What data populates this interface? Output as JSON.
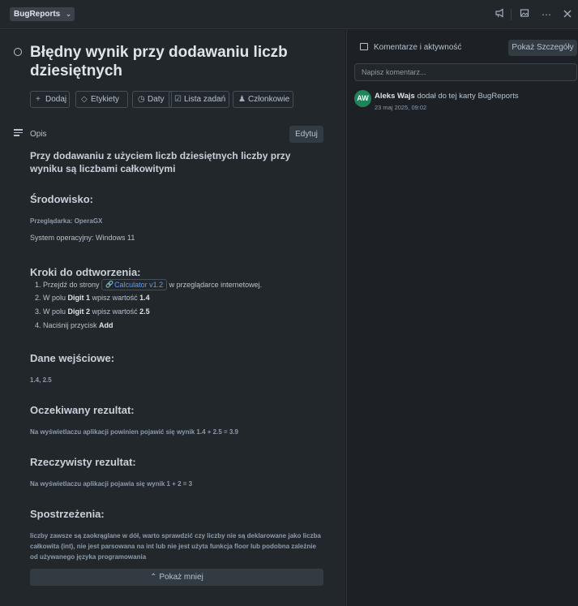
{
  "topbar": {
    "board_name": "BugReports",
    "icons": [
      "megaphone-icon",
      "image-icon",
      "more-icon",
      "close-icon"
    ]
  },
  "card": {
    "title": "Błędny wynik przy dodawaniu liczb dziesiętnych",
    "actions": [
      {
        "label": "Dodaj",
        "icon": "plus-icon"
      },
      {
        "label": "Etykiety",
        "icon": "tag-icon"
      },
      {
        "label": "Daty",
        "icon": "clock-icon"
      },
      {
        "label": "Lista zadań",
        "icon": "checklist-icon"
      },
      {
        "label": "Członkowie",
        "icon": "user-icon"
      }
    ]
  },
  "description": {
    "label": "Opis",
    "edit_label": "Edytuj",
    "lead": "Przy dodawaniu z użyciem liczb dziesiętnych liczby przy wyniku są liczbami całkowitymi",
    "env_heading": "Środowisko:",
    "browser": "Przeglądarka: OperaGX",
    "os": "System operacyjny: Windows 11",
    "steps_heading": "Kroki do odtworzenia:",
    "steps": {
      "s1_pre": "1. Przejdź do strony",
      "s1_link": "Calculator v1.2",
      "s1_post": "w przeglądarce internetowej.",
      "s2_pre": "2. W polu",
      "s2_field": "Digit 1",
      "s2_mid": "wpisz wartość",
      "s2_val": "1.4",
      "s3_pre": "3. W polu",
      "s3_field": "Digit 2",
      "s3_mid": "wpisz wartość",
      "s3_val": "2.5",
      "s4_pre": "4. Naciśnij przycisk",
      "s4_btn": "Add"
    },
    "input_heading": "Dane wejściowe:",
    "input_value": "1.4, 2.5",
    "expected_heading": "Oczekiwany rezultat:",
    "expected_text": "Na wyświetlaczu aplikacji powinien pojawić się wynik 1.4 + 2.5 = 3.9",
    "actual_heading": "Rzeczywisty rezultat:",
    "actual_text": "Na wyświetlaczu aplikacji pojawia się wynik 1 + 2 = 3",
    "notes_heading": "Spostrzeżenia:",
    "notes_text": "liczby zawsze są zaokrąglane w dół, warto sprawdzić czy liczby nie są deklarowane  jako liczba całkowita (int), nie jest parsowana na int lub nie jest użyta funkcja floor lub podobna zależnie od używanego języka programowania",
    "show_less_label": "Pokaż mniej"
  },
  "sidebar": {
    "title": "Komentarze i aktywność",
    "details_label": "Pokaż Szczegóły",
    "comment_placeholder": "Napisz komentarz...",
    "activity": {
      "initials": "AW",
      "user": "Aleks Wajs",
      "action": "dodał do tej karty BugReports",
      "time": "23 maj 2025, 09:02"
    }
  }
}
